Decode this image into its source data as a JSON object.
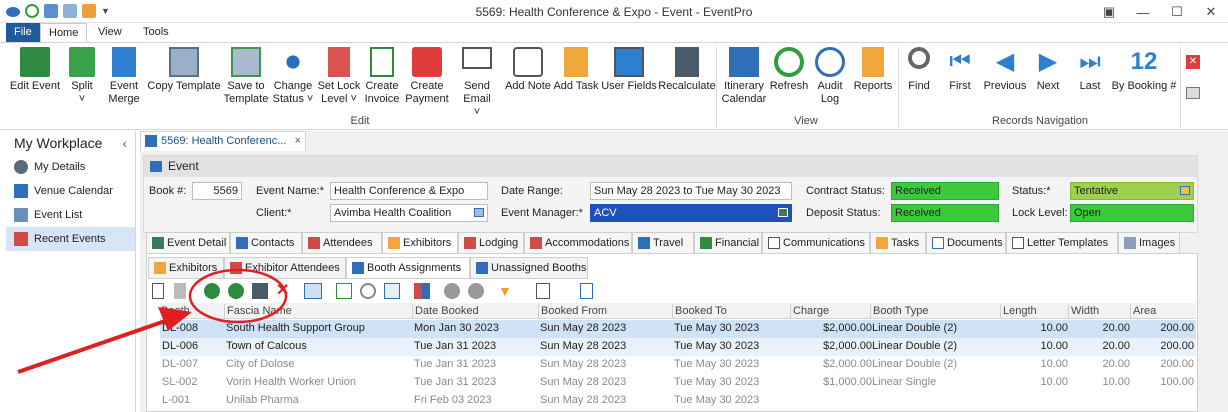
{
  "window": {
    "title": "5569: Health Conference & Expo - Event - EventPro"
  },
  "menu": {
    "file": "File",
    "home": "Home",
    "view": "View",
    "tools": "Tools"
  },
  "ribbon": {
    "buttons": [
      {
        "label1": "Edit Event",
        "label2": ""
      },
      {
        "label1": "Split",
        "label2": "˅"
      },
      {
        "label1": "Event",
        "label2": "Merge"
      },
      {
        "label1": "Copy Template",
        "label2": ""
      },
      {
        "label1": "Save to",
        "label2": "Template"
      },
      {
        "label1": "Change",
        "label2": "Status ˅"
      },
      {
        "label1": "Set Lock",
        "label2": "Level ˅"
      },
      {
        "label1": "Create",
        "label2": "Invoice"
      },
      {
        "label1": "Create",
        "label2": "Payment"
      },
      {
        "label1": "Send Email",
        "label2": "˅"
      },
      {
        "label1": "Add Note",
        "label2": ""
      },
      {
        "label1": "Add Task",
        "label2": ""
      },
      {
        "label1": "User Fields",
        "label2": ""
      },
      {
        "label1": "Recalculate",
        "label2": ""
      },
      {
        "label1": "Itinerary",
        "label2": "Calendar"
      },
      {
        "label1": "Refresh",
        "label2": ""
      },
      {
        "label1": "Audit",
        "label2": "Log"
      },
      {
        "label1": "Reports",
        "label2": ""
      },
      {
        "label1": "Find",
        "label2": ""
      },
      {
        "label1": "First",
        "label2": ""
      },
      {
        "label1": "Previous",
        "label2": ""
      },
      {
        "label1": "Next",
        "label2": ""
      },
      {
        "label1": "Last",
        "label2": ""
      },
      {
        "label1": "By Booking #",
        "label2": ""
      }
    ],
    "by_booking_number": "12",
    "groups": {
      "edit": "Edit",
      "view": "View",
      "records": "Records Navigation"
    }
  },
  "sidebar": {
    "title": "My Workplace",
    "items": [
      {
        "label": "My Details"
      },
      {
        "label": "Venue Calendar"
      },
      {
        "label": "Event List"
      },
      {
        "label": "Recent Events"
      }
    ]
  },
  "doc_tab": {
    "label": "5569: Health Conferenc..."
  },
  "event": {
    "header": "Event",
    "booking_label": "Book #:",
    "booking": "5569",
    "name_label": "Event Name:*",
    "name": "Health Conference & Expo",
    "client_label": "Client:*",
    "client": "Avimba Health Coalition",
    "date_range_label": "Date Range:",
    "date_range": "Sun May 28 2023 to Tue May 30 2023",
    "manager_label": "Event Manager:*",
    "manager": "ACV",
    "contract_label": "Contract Status:",
    "contract": "Received",
    "deposit_label": "Deposit Status:",
    "deposit": "Received",
    "status_label": "Status:*",
    "status": "Tentative",
    "lock_label": "Lock Level:",
    "lock": "Open"
  },
  "tabs": [
    {
      "label": "Event Detail"
    },
    {
      "label": "Contacts"
    },
    {
      "label": "Attendees"
    },
    {
      "label": "Exhibitors"
    },
    {
      "label": "Lodging"
    },
    {
      "label": "Accommodations"
    },
    {
      "label": "Travel"
    },
    {
      "label": "Financial"
    },
    {
      "label": "Communications"
    },
    {
      "label": "Tasks"
    },
    {
      "label": "Documents"
    },
    {
      "label": "Letter Templates"
    },
    {
      "label": "Images"
    }
  ],
  "subtabs": [
    {
      "label": "Exhibitors"
    },
    {
      "label": "Exhibitor Attendees"
    },
    {
      "label": "Booth Assignments"
    },
    {
      "label": "Unassigned Booths"
    }
  ],
  "grid": {
    "columns": [
      "Booth",
      "Fascia Name",
      "Date Booked",
      "Booked From",
      "Booked To",
      "Charge",
      "Booth Type",
      "Length",
      "Width",
      "Area"
    ],
    "rows": [
      [
        "DL-008",
        "South Health Support Group",
        "Mon Jan 30 2023",
        "Sun May 28 2023",
        "Tue May 30 2023",
        "$2,000.00",
        "Linear Double (2)",
        "10.00",
        "20.00",
        "200.00"
      ],
      [
        "DL-006",
        "Town of Calcous",
        "Tue Jan 31 2023",
        "Sun May 28 2023",
        "Tue May 30 2023",
        "$2,000.00",
        "Linear Double (2)",
        "10.00",
        "20.00",
        "200.00"
      ],
      [
        "DL-007",
        "City of Dolose",
        "Tue Jan 31 2023",
        "Sun May 28 2023",
        "Tue May 30 2023",
        "$2,000.00",
        "Linear Double (2)",
        "10.00",
        "20.00",
        "200.00"
      ],
      [
        "SL-002",
        "Vorin Health Worker Union",
        "Tue Jan 31 2023",
        "Sun May 28 2023",
        "Tue May 30 2023",
        "$1,000.00",
        "Linear Single",
        "10.00",
        "10.00",
        "100.00"
      ],
      [
        "L-001",
        "Unilab Pharma",
        "Fri Feb 03 2023",
        "Sun May 28 2023",
        "Tue May 30 2023",
        "",
        "",
        "",
        "",
        ""
      ]
    ]
  },
  "colors": {
    "accent": "#1e5a9c",
    "status_green": "#3cc93c",
    "tentative": "#9fd04e",
    "manager_blue": "#1f4fb8",
    "annotation_red": "#e02020"
  }
}
